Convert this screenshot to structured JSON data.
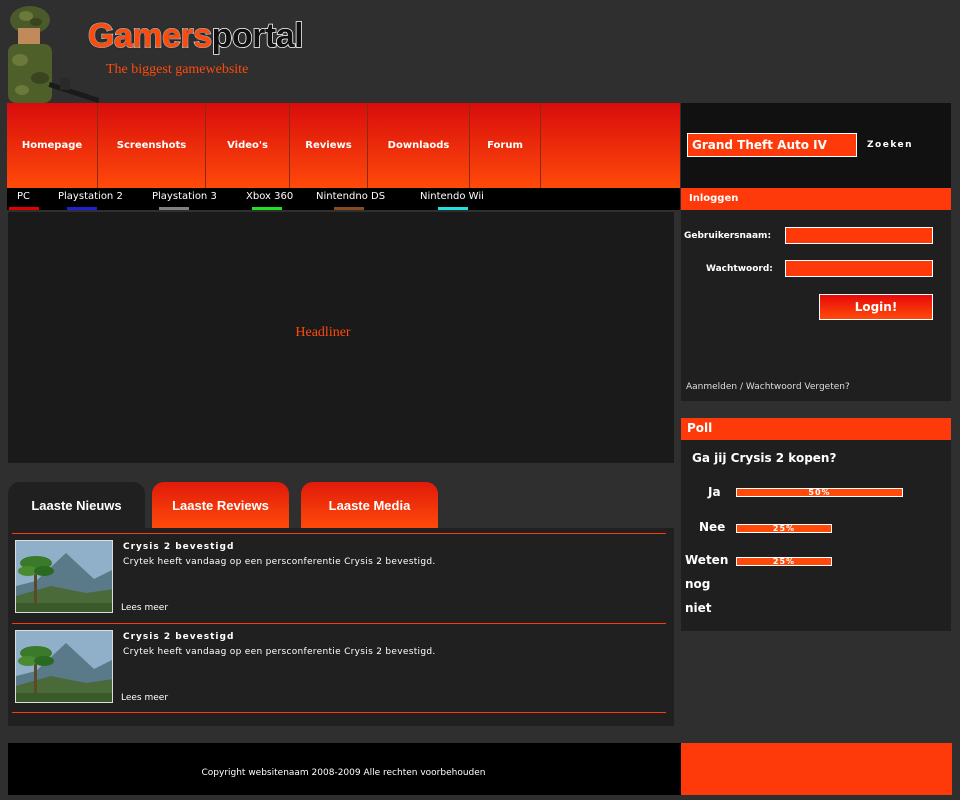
{
  "header": {
    "logo_part1": "Gamers",
    "logo_part2": "portal",
    "slogan": "The biggest gamewebsite"
  },
  "nav": {
    "items": [
      {
        "label": "Homepage"
      },
      {
        "label": "Screenshots"
      },
      {
        "label": "Video's"
      },
      {
        "label": "Reviews"
      },
      {
        "label": "Downlaods"
      },
      {
        "label": "Forum"
      }
    ]
  },
  "platforms": [
    {
      "label": "PC",
      "color": "#e00000"
    },
    {
      "label": "Playstation 2",
      "color": "#2020d0"
    },
    {
      "label": "Playstation 3",
      "color": "#808080"
    },
    {
      "label": "Xbox 360",
      "color": "#20e020"
    },
    {
      "label": "Nintendno DS",
      "color": "#8a4a20"
    },
    {
      "label": "Nintendo Wii",
      "color": "#20e0e0"
    }
  ],
  "headliner": {
    "label": "Headliner"
  },
  "tabs": [
    {
      "label": "Laaste Nieuws"
    },
    {
      "label": "Laaste Reviews"
    },
    {
      "label": "Laaste Media"
    }
  ],
  "news": [
    {
      "title": "Crysis 2 bevestigd",
      "text": "Crytek heeft vandaag op een persconferentie Crysis 2 bevestigd.",
      "read_more": "Lees meer"
    },
    {
      "title": "Crysis 2 bevestigd",
      "text": "Crytek heeft vandaag op een persconferentie Crysis 2 bevestigd.",
      "read_more": "Lees meer"
    }
  ],
  "search": {
    "value": "Grand Theft Auto IV",
    "button": "Zoeken"
  },
  "login": {
    "header": "Inloggen",
    "username_label": "Gebruikersnaam:",
    "password_label": "Wachtwoord:",
    "button": "Login!",
    "register_link": "Aanmelden",
    "separator": " / ",
    "forgot_link": "Wachtwoord Vergeten?"
  },
  "poll": {
    "header": "Poll",
    "question": "Ga jij Crysis 2 kopen?",
    "options": [
      {
        "label": "Ja",
        "percent_label": "50%",
        "percent": 50
      },
      {
        "label": "Nee",
        "percent_label": "25%",
        "percent": 25
      },
      {
        "label": "Weten nog niet",
        "percent_label": "25%",
        "percent": 25
      }
    ]
  },
  "footer": {
    "copyright": "Copyright websitenaam 2008-2009 Alle rechten voorbehouden"
  },
  "colors": {
    "accent": "#ff3a0a",
    "nav_top": "#d80c0c",
    "background": "#2f2f2f"
  }
}
